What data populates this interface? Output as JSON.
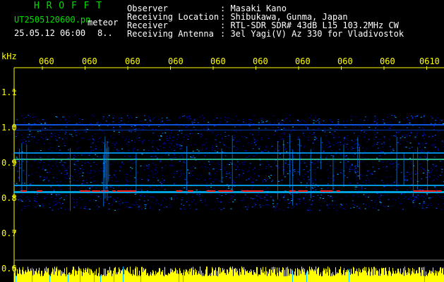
{
  "header": {
    "logo": "H R O F F T",
    "filename": "UT2505120600.pn",
    "mode": "meteor",
    "datetime": "25.05.12 06:00",
    "count": "8..",
    "fields": [
      {
        "label": "Observer",
        "value": ": Masaki Kano"
      },
      {
        "label": "Receiving Location",
        "value": ": Shibukawa, Gunma, Japan"
      },
      {
        "label": "Receiver",
        "value": ": RTL-SDR SDR# 43dB L15 103.2MHz CW"
      },
      {
        "label": "Receiving Antenna",
        "value": ": 3el Yagi(V) Az 330 for Vladivostok"
      }
    ]
  },
  "axis": {
    "unit": "kHz",
    "y_ticks": [
      "1.1",
      "1.0",
      "0.9",
      "0.8",
      "0.7",
      "0.6"
    ],
    "x_ticks": [
      "060",
      "060",
      "060",
      "060",
      "060",
      "060",
      "060",
      "060",
      "060",
      "0610"
    ]
  },
  "colors": {
    "logo": "#00e000",
    "text": "#ffffff",
    "axis": "#ffff00",
    "signal_low": "#0000aa",
    "signal_mid": "#00c0ff",
    "signal_high": "#ff2020",
    "bottom_bar": "#ffff00"
  }
}
